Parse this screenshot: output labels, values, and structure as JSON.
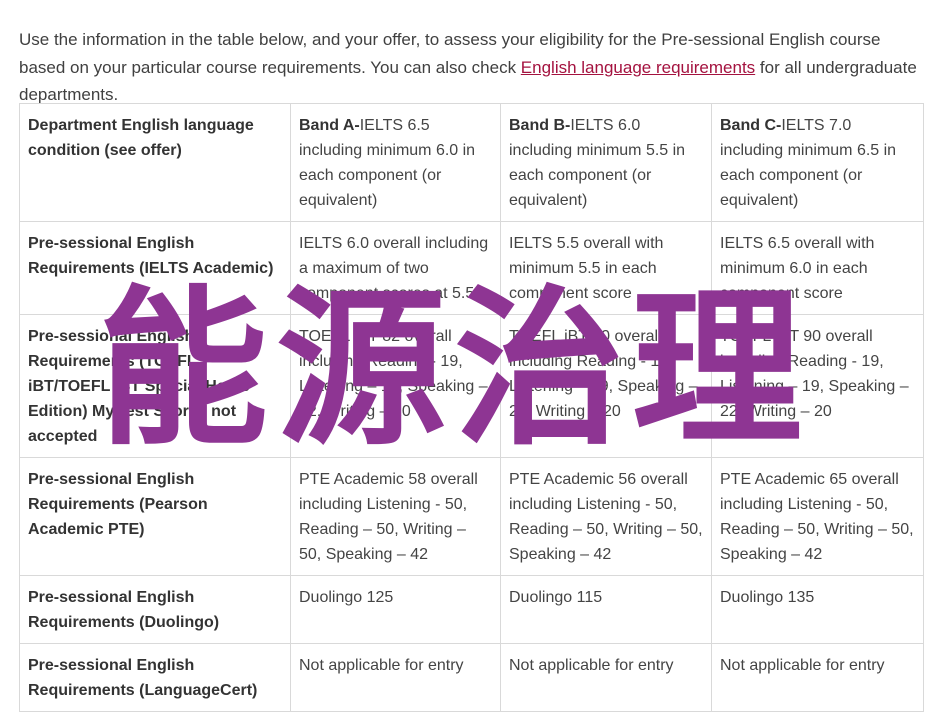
{
  "intro": {
    "text_before": "Use the information in the table below, and your offer, to assess your eligibility for the Pre-sessional English course based on your particular course requirements. You can also check ",
    "link_text": "English language requirements",
    "text_after": " for all undergraduate departments."
  },
  "table": {
    "header": {
      "first": "Department English language condition (see offer)",
      "bands": [
        {
          "name": "Band A-",
          "desc": "IELTS 6.5 including minimum 6.0 in each component (or equivalent)"
        },
        {
          "name": "Band B-",
          "desc": "IELTS 6.0 including minimum 5.5 in each component (or equivalent)"
        },
        {
          "name": "Band C-",
          "desc": "IELTS 7.0 including minimum 6.5 in each component (or equivalent)"
        }
      ]
    },
    "rows": [
      {
        "label": "Pre-sessional English Requirements (IELTS Academic)",
        "cells": [
          "IELTS 6.0 overall including a maximum of two component scores at 5.5",
          "IELTS 5.5 overall with minimum 5.5 in each component score",
          "IELTS 6.5 overall with minimum 6.0 in each component score"
        ]
      },
      {
        "label": "Pre-sessional English Requirements (TOEFL iBT/TOEFL iBT Special Home Edition) MyBest Scores not accepted",
        "cells": [
          "TOEFL iBT 82 overall including Reading - 19, Listening – 19, Speaking – 22, Writing – 20",
          "TOEFL iBT 80 overall including Reading - 19, Listening – 19, Speaking – 20, Writing – 20",
          "TOEFL iBT 90 overall including Reading - 19, Listening – 19, Speaking – 22, Writing – 20"
        ]
      },
      {
        "label": "Pre-sessional English Requirements (Pearson Academic PTE)",
        "cells": [
          "PTE Academic 58 overall including Listening - 50, Reading – 50, Writing – 50, Speaking – 42",
          "PTE Academic 56 overall including Listening - 50, Reading – 50, Writing – 50, Speaking – 42",
          "PTE Academic 65 overall including Listening - 50, Reading – 50, Writing – 50, Speaking – 42"
        ]
      },
      {
        "label": "Pre-sessional English Requirements (Duolingo)",
        "cells": [
          "Duolingo 125",
          "Duolingo 115",
          "Duolingo 135"
        ]
      },
      {
        "label": "Pre-sessional English Requirements (LanguageCert)",
        "cells": [
          "Not applicable for entry",
          "Not applicable for entry",
          "Not applicable for entry"
        ]
      }
    ]
  },
  "watermark": {
    "text": "能源治理",
    "color": "#8e3593"
  },
  "colors": {
    "link": "#a4123f",
    "border": "#d9d9d9"
  }
}
